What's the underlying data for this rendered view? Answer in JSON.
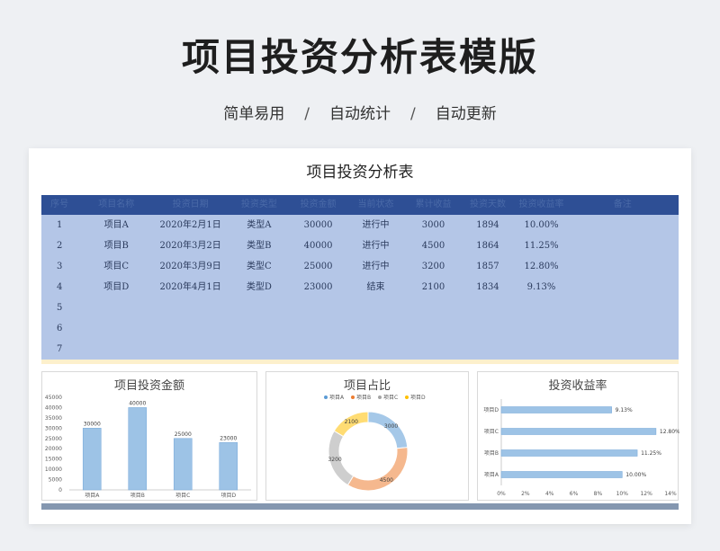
{
  "hero": {
    "title": "项目投资分析表模版",
    "tags": [
      "简单易用",
      "自动统计",
      "自动更新"
    ],
    "separator": "/"
  },
  "sheet": {
    "title": "项目投资分析表",
    "columns": [
      "序号",
      "项目名称",
      "投资日期",
      "投资类型",
      "投资金额",
      "当前状态",
      "累计收益",
      "投资天数",
      "投资收益率",
      "备注"
    ],
    "rows": [
      [
        "1",
        "项目A",
        "2020年2月1日",
        "类型A",
        "30000",
        "进行中",
        "3000",
        "1894",
        "10.00%",
        ""
      ],
      [
        "2",
        "项目B",
        "2020年3月2日",
        "类型B",
        "40000",
        "进行中",
        "4500",
        "1864",
        "11.25%",
        ""
      ],
      [
        "3",
        "项目C",
        "2020年3月9日",
        "类型C",
        "25000",
        "进行中",
        "3200",
        "1857",
        "12.80%",
        ""
      ],
      [
        "4",
        "项目D",
        "2020年4月1日",
        "类型D",
        "23000",
        "结束",
        "2100",
        "1834",
        "9.13%",
        ""
      ],
      [
        "5",
        "",
        "",
        "",
        "",
        "",
        "",
        "",
        "",
        ""
      ],
      [
        "6",
        "",
        "",
        "",
        "",
        "",
        "",
        "",
        "",
        ""
      ],
      [
        "7",
        "",
        "",
        "",
        "",
        "",
        "",
        "",
        "",
        ""
      ]
    ]
  },
  "chart_data": [
    {
      "type": "bar",
      "title": "项目投资金额",
      "categories": [
        "项目A",
        "项目B",
        "项目C",
        "项目D"
      ],
      "values": [
        30000,
        40000,
        25000,
        23000
      ],
      "ylim": [
        0,
        45000
      ],
      "yticks": [
        "0",
        "5000",
        "10000",
        "15000",
        "20000",
        "25000",
        "30000",
        "35000",
        "40000",
        "45000"
      ],
      "data_labels": [
        "30000",
        "40000",
        "25000",
        "23000"
      ],
      "color": "#9dc3e6"
    },
    {
      "type": "pie",
      "title": "项目占比",
      "categories": [
        "项目A",
        "项目B",
        "项目C",
        "项目D"
      ],
      "values": [
        3000,
        4500,
        3200,
        2100
      ],
      "data_labels": [
        "3000",
        "4500",
        "3200",
        "2100"
      ],
      "colors": [
        "#5b9bd5",
        "#ed7d31",
        "#a5a5a5",
        "#ffc000"
      ],
      "legend": "top"
    },
    {
      "type": "bar",
      "orientation": "horizontal",
      "title": "投资收益率",
      "categories": [
        "项目A",
        "项目B",
        "项目C",
        "项目D"
      ],
      "values": [
        10.0,
        11.25,
        12.8,
        9.13
      ],
      "data_labels": [
        "10.00%",
        "11.25%",
        "12.80%",
        "9.13%"
      ],
      "xlim": [
        0,
        14
      ],
      "xticks": [
        "0%",
        "2%",
        "4%",
        "6%",
        "8%",
        "10%",
        "12%",
        "14%"
      ],
      "color": "#9dc3e6"
    }
  ]
}
